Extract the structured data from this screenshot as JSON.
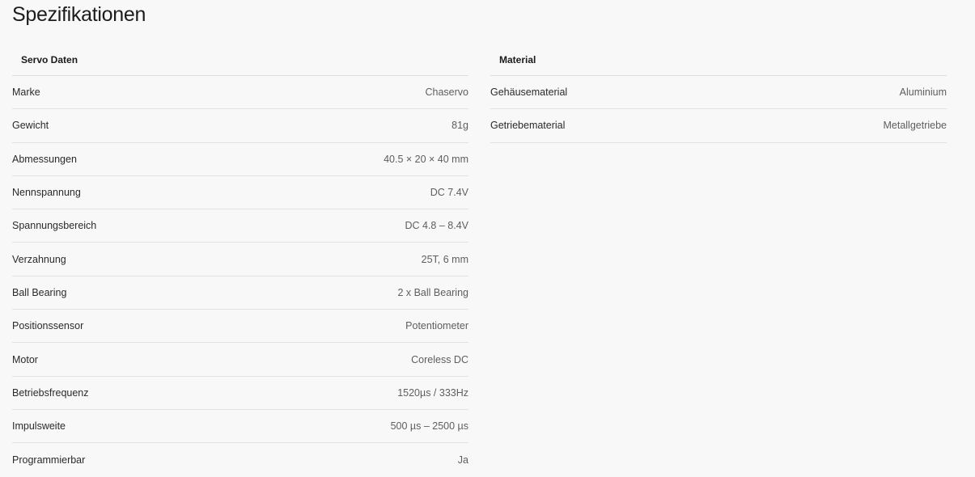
{
  "page": {
    "title": "Spezifikationen"
  },
  "servo_table": {
    "header": "Servo Daten",
    "rows": [
      {
        "label": "Marke",
        "value": "Chaservo"
      },
      {
        "label": "Gewicht",
        "value": "81g"
      },
      {
        "label": "Abmessungen",
        "value": "40.5 × 20 × 40 mm"
      },
      {
        "label": "Nennspannung",
        "value": "DC 7.4V"
      },
      {
        "label": "Spannungsbereich",
        "value": "DC 4.8 – 8.4V"
      },
      {
        "label": "Verzahnung",
        "value": "25T, 6 mm"
      },
      {
        "label": "Ball Bearing",
        "value": "2 x Ball Bearing"
      },
      {
        "label": "Positionssensor",
        "value": "Potentiometer"
      },
      {
        "label": "Motor",
        "value": "Coreless DC"
      },
      {
        "label": "Betriebsfrequenz",
        "value": "1520µs / 333Hz"
      },
      {
        "label": "Impulsweite",
        "value": "500 µs – 2500 µs"
      },
      {
        "label": "Programmierbar",
        "value": "Ja"
      }
    ]
  },
  "material_table": {
    "header": "Material",
    "rows": [
      {
        "label": "Gehäusematerial",
        "value": "Aluminium"
      },
      {
        "label": "Getriebematerial",
        "value": "Metallgetriebe"
      }
    ]
  }
}
